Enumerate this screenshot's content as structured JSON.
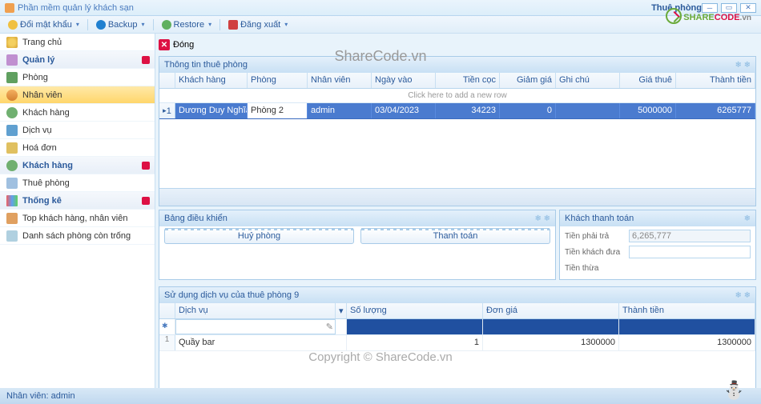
{
  "window": {
    "app_title": "Phần mềm quản lý khách sạn",
    "active_tab": "Thuê phòng",
    "min_tooltip": "Minimize",
    "max_tooltip": "Maximize",
    "close_tooltip": "Close"
  },
  "menubar": {
    "change_password": "Đổi mật khẩu",
    "backup": "Backup",
    "restore": "Restore",
    "logout": "Đăng xuất"
  },
  "sidebar": {
    "items": [
      {
        "label": "Trang chủ",
        "icon": "home",
        "header": false
      },
      {
        "label": "Quản lý",
        "icon": "manage",
        "header": true,
        "badge": true
      },
      {
        "label": "Phòng",
        "icon": "room"
      },
      {
        "label": "Nhân viên",
        "icon": "staff",
        "selected": true
      },
      {
        "label": "Khách hàng",
        "icon": "cust"
      },
      {
        "label": "Dịch vụ",
        "icon": "service"
      },
      {
        "label": "Hoá đơn",
        "icon": "invoice"
      },
      {
        "label": "Khách hàng",
        "icon": "cust",
        "header": true,
        "badge": true
      },
      {
        "label": "Thuê phòng",
        "icon": "rent"
      },
      {
        "label": "Thống kê",
        "icon": "stats",
        "header": true,
        "badge": true
      },
      {
        "label": "Top khách hàng, nhân viên",
        "icon": "top"
      },
      {
        "label": "Danh sách phòng còn trống",
        "icon": "list"
      }
    ]
  },
  "content": {
    "close_label": "Đóng",
    "info_panel_title": "Thông tin thuê phòng",
    "grid_columns": [
      "Khách hàng",
      "Phòng",
      "Nhân viên",
      "Ngày vào",
      "Tiền cọc",
      "Giảm giá",
      "Ghi chú",
      "Giá thuê",
      "Thành tiền"
    ],
    "grid_newrow_hint": "Click here to add a new row",
    "grid_rows": [
      {
        "num": "1",
        "customer": "Dương Duy Nghĩa",
        "room": "Phòng 2",
        "staff": "admin",
        "date": "03/04/2023",
        "deposit": "34223",
        "discount": "0",
        "note": "",
        "price": "5000000",
        "total": "6265777"
      }
    ],
    "control_panel_title": "Bảng điều khiển",
    "cancel_room_btn": "Huỷ phòng",
    "pay_btn": "Thanh toán",
    "payment_panel_title": "Khách thanh toán",
    "payment_due_label": "Tiền phải trả",
    "payment_due_value": "6,265,777",
    "payment_given_label": "Tiền khách đưa",
    "payment_given_value": "",
    "payment_change_label": "Tiền thừa",
    "payment_change_value": "",
    "service_panel_title": "Sử dụng dịch vụ của thuê phòng 9",
    "service_columns": [
      "Dịch vụ",
      "Số lượng",
      "Đơn giá",
      "Thành tiền"
    ],
    "service_rows": [
      {
        "num": "1",
        "name": "Quầy bar",
        "qty": "1",
        "price": "1300000",
        "total": "1300000"
      }
    ]
  },
  "statusbar": {
    "staff_label": "Nhân viên: admin"
  },
  "watermarks": {
    "center": "ShareCode.vn",
    "bottom": "Copyright © ShareCode.vn",
    "logo_share": "SHARE",
    "logo_code": "CODE",
    "logo_vn": ".vn"
  }
}
